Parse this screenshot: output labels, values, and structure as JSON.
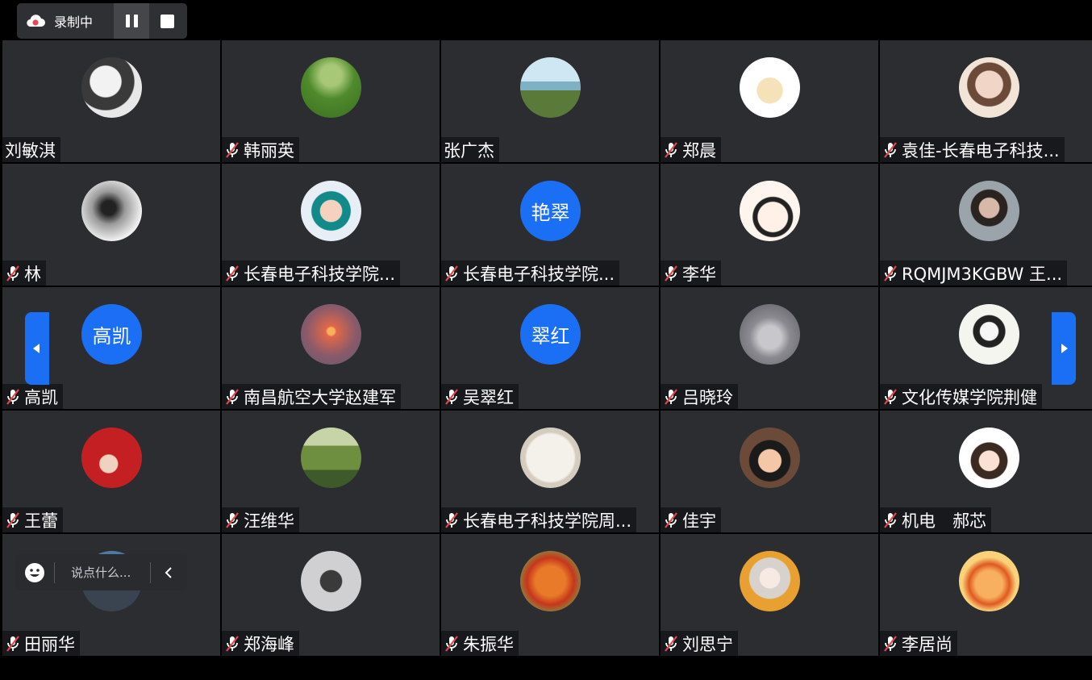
{
  "recording": {
    "status_label": "录制中",
    "icons": [
      "cloud-record-icon",
      "pause-icon",
      "stop-icon"
    ]
  },
  "colors": {
    "avatar_text_bg": "#1b6ff5",
    "tile_bg": "#2b2d31",
    "name_tag_bg": "#18191c",
    "mic_muted": "#e5484d"
  },
  "participants": [
    {
      "name": "刘敏淇",
      "muted": false,
      "avatar_text": ""
    },
    {
      "name": "韩丽英",
      "muted": true,
      "avatar_text": ""
    },
    {
      "name": "张广杰",
      "muted": false,
      "avatar_text": ""
    },
    {
      "name": "郑晨",
      "muted": true,
      "avatar_text": ""
    },
    {
      "name": "袁佳-长春电子科技...",
      "muted": true,
      "avatar_text": ""
    },
    {
      "name": "林",
      "muted": true,
      "avatar_text": ""
    },
    {
      "name": "长春电子科技学院...",
      "muted": true,
      "avatar_text": ""
    },
    {
      "name": "长春电子科技学院...",
      "muted": true,
      "avatar_text": "艳翠"
    },
    {
      "name": "李华",
      "muted": true,
      "avatar_text": ""
    },
    {
      "name": "RQMJM3KGBW 王...",
      "muted": true,
      "avatar_text": ""
    },
    {
      "name": "高凯",
      "muted": true,
      "avatar_text": "高凯"
    },
    {
      "name": "南昌航空大学赵建军",
      "muted": true,
      "avatar_text": ""
    },
    {
      "name": "吴翠红",
      "muted": true,
      "avatar_text": "翠红"
    },
    {
      "name": "吕晓玲",
      "muted": true,
      "avatar_text": ""
    },
    {
      "name": "文化传媒学院荆健",
      "muted": true,
      "avatar_text": ""
    },
    {
      "name": "王蕾",
      "muted": true,
      "avatar_text": ""
    },
    {
      "name": "汪维华",
      "muted": true,
      "avatar_text": ""
    },
    {
      "name": "长春电子科技学院周...",
      "muted": true,
      "avatar_text": ""
    },
    {
      "name": "佳宇",
      "muted": true,
      "avatar_text": ""
    },
    {
      "name": "机电　郝芯",
      "muted": true,
      "avatar_text": ""
    },
    {
      "name": "田丽华",
      "muted": true,
      "avatar_text": ""
    },
    {
      "name": "郑海峰",
      "muted": true,
      "avatar_text": ""
    },
    {
      "name": "朱振华",
      "muted": true,
      "avatar_text": ""
    },
    {
      "name": "刘思宁",
      "muted": true,
      "avatar_text": ""
    },
    {
      "name": "李居尚",
      "muted": true,
      "avatar_text": ""
    }
  ],
  "chat": {
    "placeholder": "说点什么..."
  },
  "navigation": {
    "prev_icon": "arrow-left-icon",
    "next_icon": "arrow-right-icon"
  }
}
